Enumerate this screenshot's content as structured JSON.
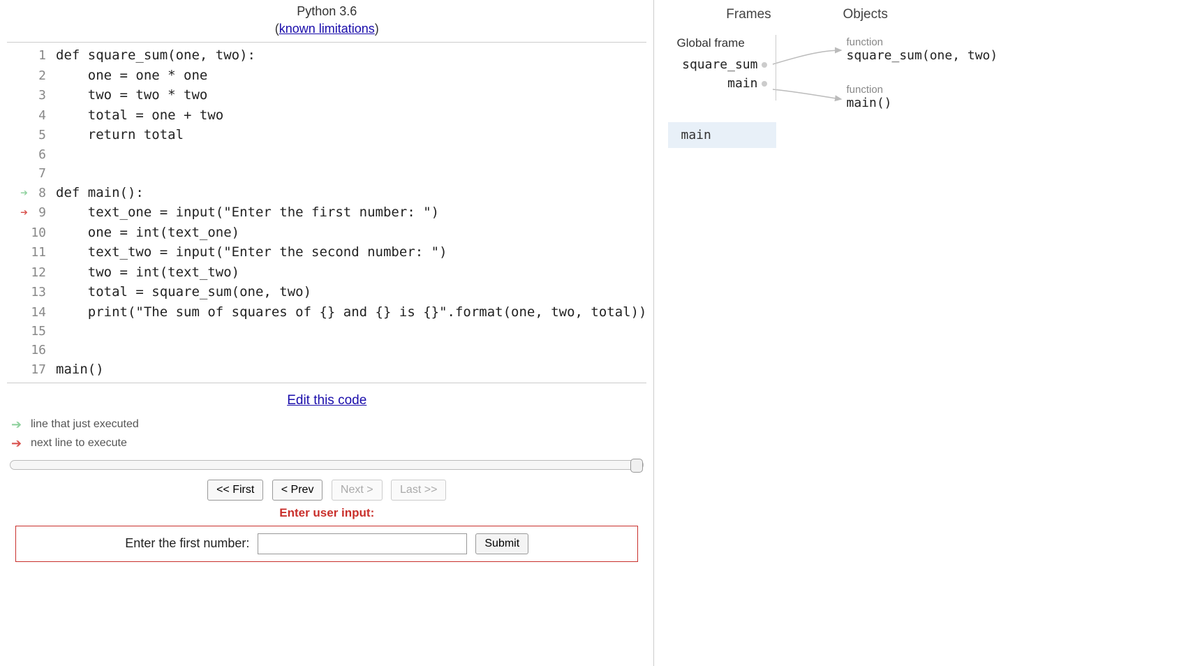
{
  "header": {
    "title": "Python 3.6",
    "limitations_link": "known limitations"
  },
  "code": {
    "lines": [
      {
        "n": 1,
        "text": "def square_sum(one, two):"
      },
      {
        "n": 2,
        "text": "    one = one * one"
      },
      {
        "n": 3,
        "text": "    two = two * two"
      },
      {
        "n": 4,
        "text": "    total = one + two"
      },
      {
        "n": 5,
        "text": "    return total"
      },
      {
        "n": 6,
        "text": ""
      },
      {
        "n": 7,
        "text": ""
      },
      {
        "n": 8,
        "text": "def main():"
      },
      {
        "n": 9,
        "text": "    text_one = input(\"Enter the first number: \")"
      },
      {
        "n": 10,
        "text": "    one = int(text_one)"
      },
      {
        "n": 11,
        "text": "    text_two = input(\"Enter the second number: \")"
      },
      {
        "n": 12,
        "text": "    two = int(text_two)"
      },
      {
        "n": 13,
        "text": "    total = square_sum(one, two)"
      },
      {
        "n": 14,
        "text": "    print(\"The sum of squares of {} and {} is {}\".format(one, two, total))"
      },
      {
        "n": 15,
        "text": ""
      },
      {
        "n": 16,
        "text": ""
      },
      {
        "n": 17,
        "text": "main()"
      }
    ],
    "just_executed_line": 8,
    "next_line": 9
  },
  "edit_link": "Edit this code",
  "legend": {
    "just_executed": "line that just executed",
    "next_line": "next line to execute"
  },
  "nav": {
    "first": "<< First",
    "prev": "< Prev",
    "next": "Next >",
    "last": "Last >>",
    "next_disabled": true,
    "last_disabled": true
  },
  "user_input": {
    "heading": "Enter user input:",
    "prompt": "Enter the first number:",
    "value": "",
    "submit": "Submit"
  },
  "viz": {
    "frames_label": "Frames",
    "objects_label": "Objects",
    "global_frame_title": "Global frame",
    "global_vars": [
      "square_sum",
      "main"
    ],
    "objects": [
      {
        "type": "function",
        "repr": "square_sum(one, two)"
      },
      {
        "type": "function",
        "repr": "main()"
      }
    ],
    "call_frame": "main"
  }
}
